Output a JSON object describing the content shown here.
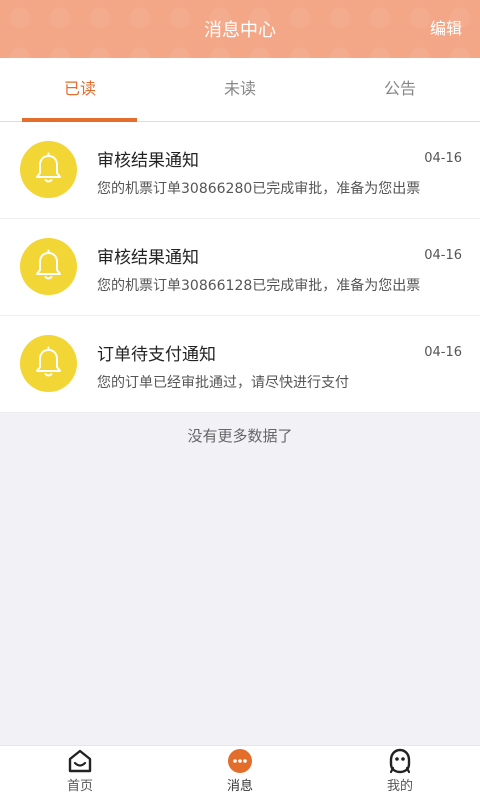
{
  "header": {
    "title": "消息中心",
    "edit_label": "编辑"
  },
  "tabs": [
    {
      "label": "已读",
      "active": true
    },
    {
      "label": "未读",
      "active": false
    },
    {
      "label": "公告",
      "active": false
    }
  ],
  "messages": [
    {
      "icon": "bell-icon",
      "title": "审核结果通知",
      "date": "04-16",
      "desc": "您的机票订单30866280已完成审批，准备为您出票"
    },
    {
      "icon": "bell-icon",
      "title": "审核结果通知",
      "date": "04-16",
      "desc": "您的机票订单30866128已完成审批，准备为您出票"
    },
    {
      "icon": "bell-icon",
      "title": "订单待支付通知",
      "date": "04-16",
      "desc": "您的订单已经审批通过，请尽快进行支付"
    }
  ],
  "no_more_text": "没有更多数据了",
  "bottom_nav": [
    {
      "label": "首页",
      "icon": "home-icon"
    },
    {
      "label": "消息",
      "icon": "message-icon",
      "active": true
    },
    {
      "label": "我的",
      "icon": "profile-icon"
    }
  ],
  "colors": {
    "accent": "#e36d2b",
    "header_bg": "#f3a787",
    "bell_bg": "#f2d636",
    "page_bg": "#f2f1f6"
  }
}
